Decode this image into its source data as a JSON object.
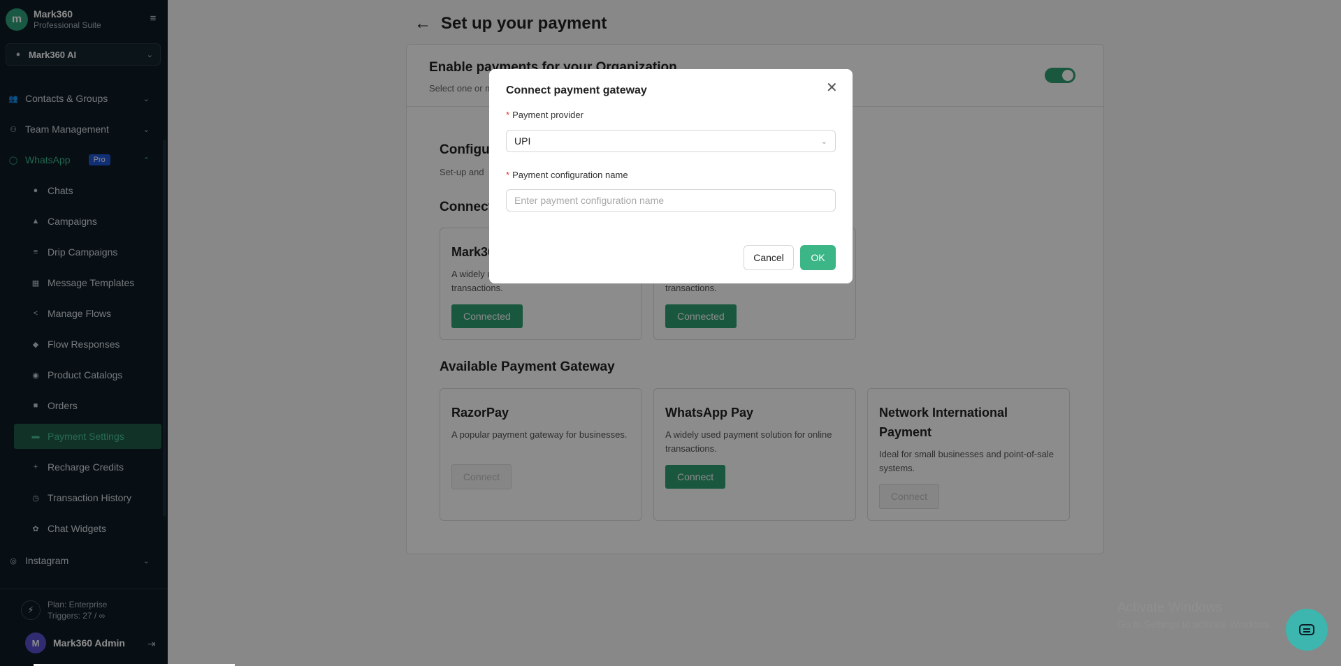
{
  "sidebar": {
    "brand_name": "Mark360",
    "brand_sub": "Professional Suite",
    "org": "Mark360 AI",
    "items": [
      {
        "label": "Contacts & Groups"
      },
      {
        "label": "Team Management"
      },
      {
        "label": "WhatsApp",
        "badge": "Pro"
      },
      {
        "label": "Instagram"
      }
    ],
    "sub_items": [
      {
        "label": "Chats",
        "icon": "chat-icon"
      },
      {
        "label": "Campaigns",
        "icon": "bell-icon"
      },
      {
        "label": "Drip Campaigns",
        "icon": "list-icon"
      },
      {
        "label": "Message Templates",
        "icon": "template-icon"
      },
      {
        "label": "Manage Flows",
        "icon": "share-icon"
      },
      {
        "label": "Flow Responses",
        "icon": "responses-icon"
      },
      {
        "label": "Product Catalogs",
        "icon": "eye-icon"
      },
      {
        "label": "Orders",
        "icon": "lock-icon"
      },
      {
        "label": "Payment Settings",
        "icon": "card-icon"
      },
      {
        "label": "Recharge Credits",
        "icon": "plus-icon"
      },
      {
        "label": "Transaction History",
        "icon": "history-icon"
      },
      {
        "label": "Chat Widgets",
        "icon": "widget-icon"
      }
    ],
    "plan": "Plan: Enterprise",
    "triggers": "Triggers: 27 / ∞",
    "user_initial": "M",
    "user_name": "Mark360 Admin"
  },
  "main": {
    "page_title": "Set up your payment",
    "enable_title": "Enable payments for your Organization",
    "enable_sub": "Select one or more payment methods",
    "config_title": "Configure",
    "config_sub": "Set-up and",
    "connected_title": "Connected",
    "connected": [
      {
        "title": "Mark360",
        "desc": "A widely used payment solution for online transactions.",
        "button": "Connected"
      },
      {
        "title": "",
        "desc": "A widely used payment solution for online transactions.",
        "button": "Connected"
      }
    ],
    "available_title": "Available Payment Gateway",
    "available": [
      {
        "title": "RazorPay",
        "desc": "A popular payment gateway for businesses.",
        "button": "Connect",
        "enabled": false
      },
      {
        "title": "WhatsApp Pay",
        "desc": "A widely used payment solution for online transactions.",
        "button": "Connect",
        "enabled": true
      },
      {
        "title": "Network International Payment",
        "desc": "Ideal for small businesses and point-of-sale systems.",
        "button": "Connect",
        "enabled": false
      }
    ]
  },
  "modal": {
    "title": "Connect payment gateway",
    "provider_label": "Payment provider",
    "provider_value": "UPI",
    "name_label": "Payment configuration name",
    "name_placeholder": "Enter payment configuration name",
    "cancel": "Cancel",
    "ok": "OK"
  },
  "watermark": {
    "line1": "Activate Windows",
    "line2": "Go to Settings to activate Windows."
  },
  "colors": {
    "accent": "#2f9e72",
    "sidebar_bg": "#0e1c26",
    "pro_badge": "#1f57d6"
  }
}
